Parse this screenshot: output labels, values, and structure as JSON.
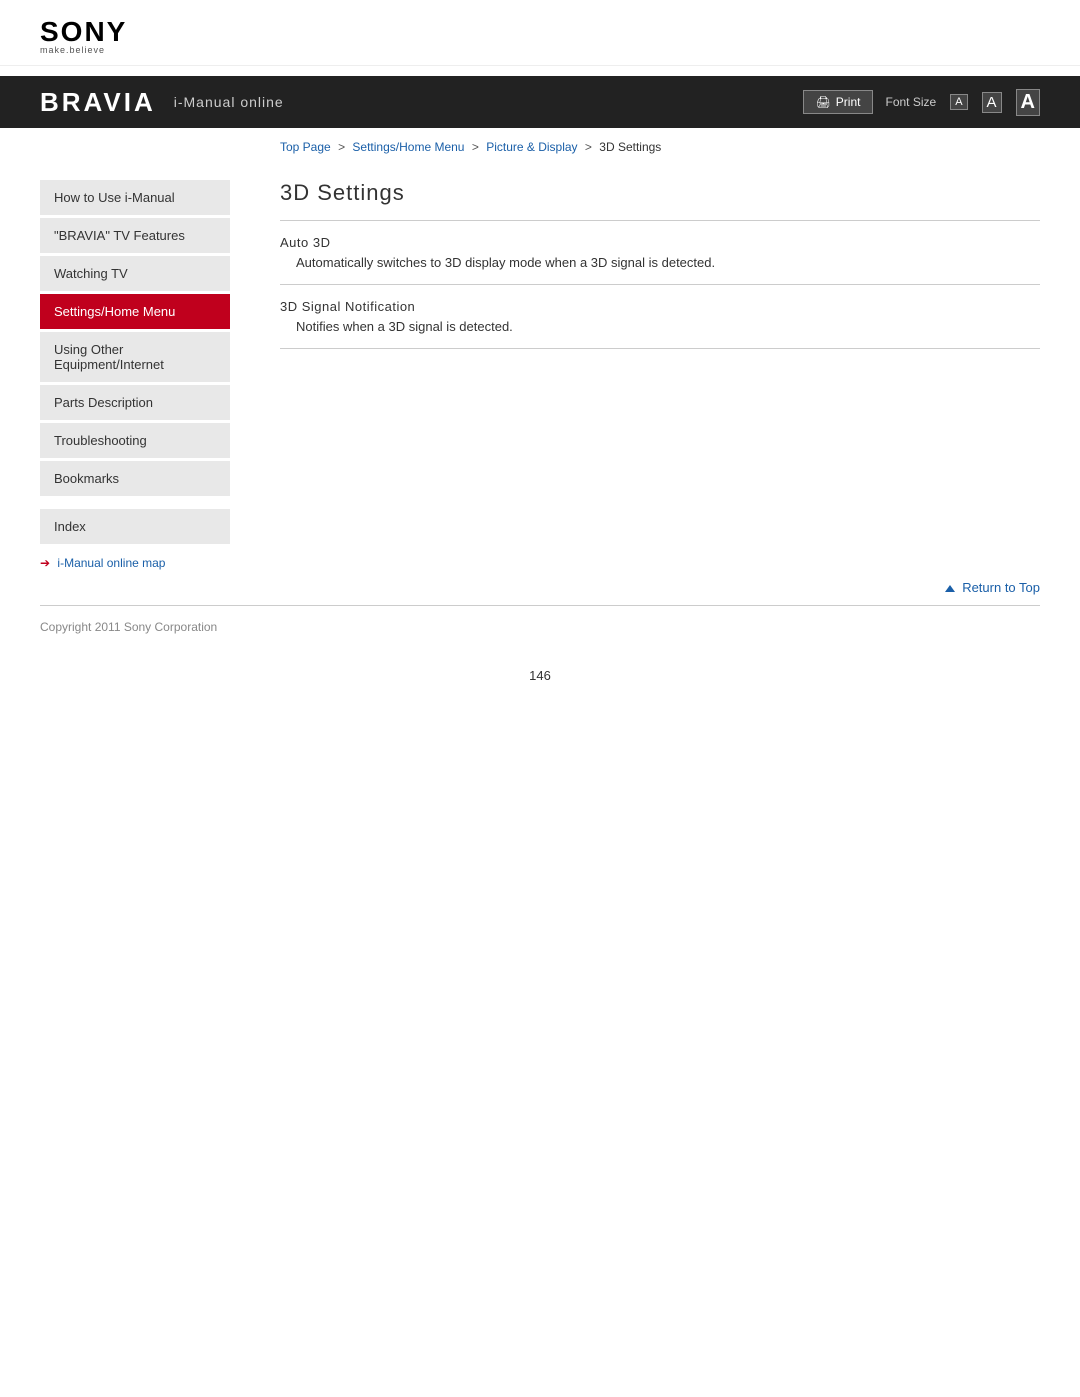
{
  "logo": {
    "brand": "SONY",
    "tagline": "make.believe"
  },
  "header": {
    "bravia_title": "BRAVIA",
    "subtitle": "i-Manual online",
    "print_label": "Print",
    "font_size_label": "Font Size",
    "font_size_small": "A",
    "font_size_medium": "A",
    "font_size_large": "A"
  },
  "breadcrumb": {
    "items": [
      {
        "label": "Top Page",
        "href": "#"
      },
      {
        "label": "Settings/Home Menu",
        "href": "#"
      },
      {
        "label": "Picture & Display",
        "href": "#"
      },
      {
        "label": "3D Settings",
        "href": null
      }
    ]
  },
  "sidebar": {
    "items": [
      {
        "label": "How to Use i-Manual",
        "active": false
      },
      {
        "label": "\"BRAVIA\" TV Features",
        "active": false
      },
      {
        "label": "Watching TV",
        "active": false
      },
      {
        "label": "Settings/Home Menu",
        "active": true
      },
      {
        "label": "Using Other Equipment/Internet",
        "active": false
      },
      {
        "label": "Parts Description",
        "active": false
      },
      {
        "label": "Troubleshooting",
        "active": false
      },
      {
        "label": "Bookmarks",
        "active": false
      }
    ],
    "index_label": "Index",
    "map_link": "i-Manual online map"
  },
  "content": {
    "page_title": "3D Settings",
    "sections": [
      {
        "title": "Auto 3D",
        "description": "Automatically switches to 3D display mode when a 3D signal is detected."
      },
      {
        "title": "3D Signal Notification",
        "description": "Notifies when a 3D signal is detected."
      }
    ]
  },
  "return_top": "Return to Top",
  "footer": {
    "copyright": "Copyright 2011 Sony Corporation"
  },
  "page_number": "146"
}
